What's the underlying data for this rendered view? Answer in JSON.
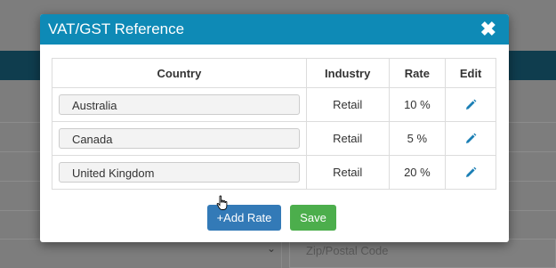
{
  "background": {
    "zip_placeholder": "Zip/Postal Code",
    "chevron": "⌄"
  },
  "modal": {
    "title": "VAT/GST Reference",
    "close_symbol": "✖",
    "header_color": "#0e8ab6",
    "columns": {
      "country": "Country",
      "industry": "Industry",
      "rate": "Rate",
      "edit": "Edit"
    },
    "rows": [
      {
        "country": "Australia",
        "industry": "Retail",
        "rate": "10 %",
        "edit_icon": "pencil-icon"
      },
      {
        "country": "Canada",
        "industry": "Retail",
        "rate": "5 %",
        "edit_icon": "pencil-icon"
      },
      {
        "country": "United Kingdom",
        "industry": "Retail",
        "rate": "20 %",
        "edit_icon": "pencil-icon"
      }
    ],
    "buttons": {
      "add_rate": "+Add Rate",
      "save": "Save"
    },
    "colors": {
      "add_rate": "#337ab7",
      "save": "#4cae4c",
      "edit_icon": "#1b7fb5"
    }
  }
}
